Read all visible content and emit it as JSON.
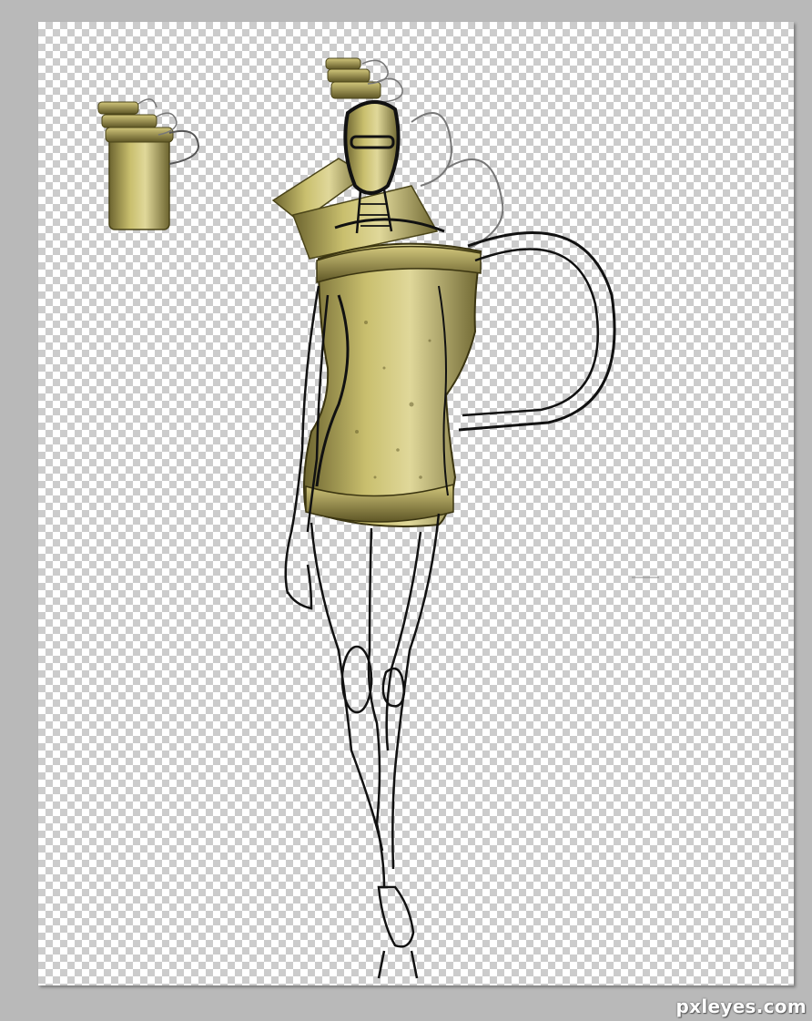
{
  "document": {
    "canvas_background": "transparency-checkerboard",
    "workspace_color": "#b9b9b9",
    "artwork": {
      "subject": "fashion-figure-sketch",
      "palette": {
        "brass": "#b8ac5a",
        "brass_dark": "#6d6530",
        "brass_light": "#e0d89a",
        "ink": "#111111"
      }
    },
    "watermark": "pxleyes.com"
  }
}
